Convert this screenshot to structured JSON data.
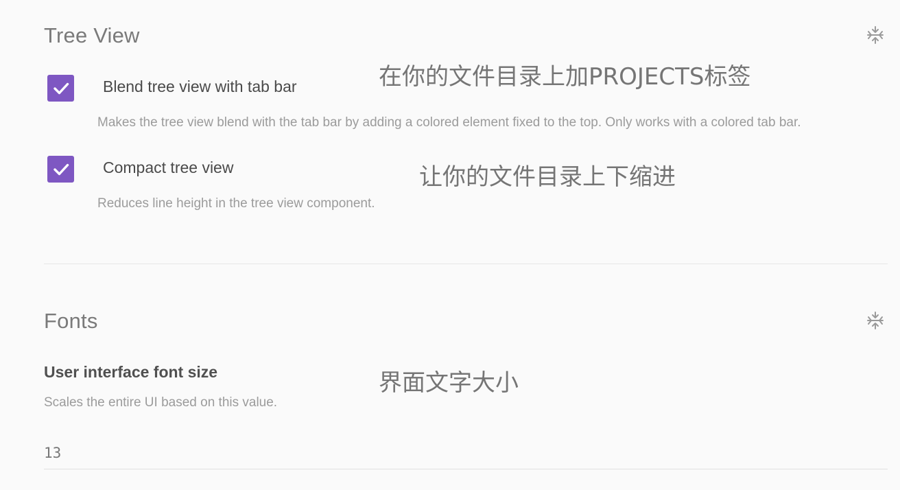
{
  "tree_view": {
    "title": "Tree View",
    "collapse_icon": "collapse-icon",
    "options": [
      {
        "label": "Blend tree view with tab bar",
        "checked": true,
        "description": "Makes the tree view blend with the tab bar by adding a colored element fixed to the top. Only works with a colored tab bar."
      },
      {
        "label": "Compact tree view",
        "checked": true,
        "description": "Reduces line height in the tree view component."
      }
    ],
    "annotations": [
      "在你的文件目录上加PROJECTS标签",
      "让你的文件目录上下缩进"
    ]
  },
  "fonts": {
    "title": "Fonts",
    "collapse_icon": "collapse-icon",
    "ui_font_size": {
      "label": "User interface font size",
      "description": "Scales the entire UI based on this value.",
      "value": "13"
    },
    "annotation": "界面文字大小"
  },
  "colors": {
    "accent": "#7e57c2",
    "background": "#fafafa",
    "divider": "#e6e6e6"
  }
}
